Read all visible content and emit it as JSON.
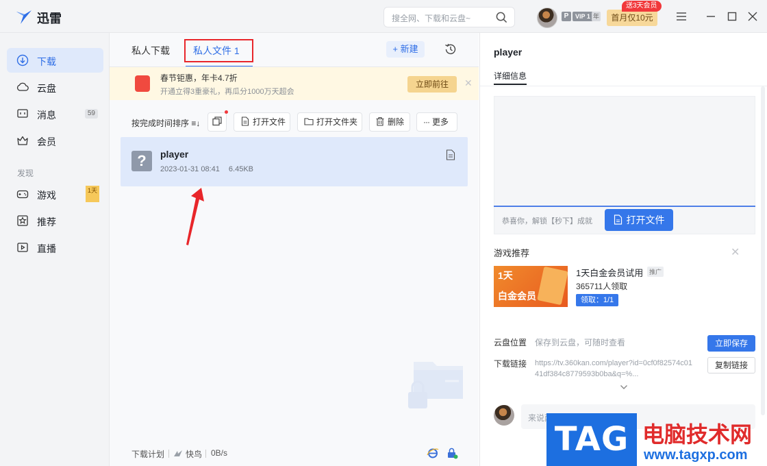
{
  "app": {
    "name": "迅雷"
  },
  "search": {
    "placeholder": "搜全网、下载和云盘~"
  },
  "account": {
    "p_badge": "P",
    "vip_badge": "VIP 1",
    "year_badge": "年",
    "promo_label": "首月仅10元",
    "promo_badge": "送3天会员"
  },
  "sidebar": {
    "items": [
      {
        "label": "下载",
        "icon": "download-icon",
        "active": true
      },
      {
        "label": "云盘",
        "icon": "cloud-icon"
      },
      {
        "label": "消息",
        "icon": "message-icon",
        "count": "59"
      },
      {
        "label": "会员",
        "icon": "crown-icon"
      }
    ],
    "section_label": "发现",
    "discover": [
      {
        "label": "游戏",
        "icon": "gamepad-icon",
        "thumb": "1天"
      },
      {
        "label": "推荐",
        "icon": "star-icon"
      },
      {
        "label": "直播",
        "icon": "live-icon"
      }
    ]
  },
  "tabs": {
    "download": "私人下载",
    "private": "私人文件 1"
  },
  "new_button": "+ 新建",
  "banner": {
    "title": "春节钜惠，年卡4.7折",
    "subtitle": "开通立得3重豪礼，再瓜分1000万天超会",
    "go": "立即前往"
  },
  "toolbar": {
    "sort": "按完成时间排序 ≡↓",
    "open_file": "打开文件",
    "open_folder": "打开文件夹",
    "delete": "删除",
    "more": "更多"
  },
  "file": {
    "name": "player",
    "date": "2023-01-31 08:41",
    "size": "6.45KB"
  },
  "status": {
    "plan": "下载计划",
    "fast": "快鸟",
    "speed": "0B/s"
  },
  "detail": {
    "title": "player",
    "tab": "详细信息",
    "open_file": "打开文件",
    "unlock_note": "恭喜你，解锁【秒下】成就",
    "game_section": "游戏推荐",
    "game_name": "1天白金会员试用",
    "ad_tag": "推广",
    "game_count": "365711人领取",
    "claim": "领取：1/1",
    "thumb_big": "1天",
    "thumb_big2": "白金会员",
    "cloud_label": "云盘位置",
    "cloud_desc": "保存到云盘，可随时查看",
    "save": "立即保存",
    "link_label": "下载链接",
    "link_value": "https://tv.360kan.com/player?id=0cf0f82574c0141df384c8779593b0ba&q=%...",
    "copy": "复制链接",
    "comment_placeholder": "来说两句…"
  },
  "watermark": {
    "tag": "TAG",
    "cn": "电脑技术网",
    "url": "www.tagxp.com"
  },
  "colors": {
    "accent": "#2f6ee6",
    "highlight_box": "#e8262a",
    "arrow": "#e8262a"
  }
}
